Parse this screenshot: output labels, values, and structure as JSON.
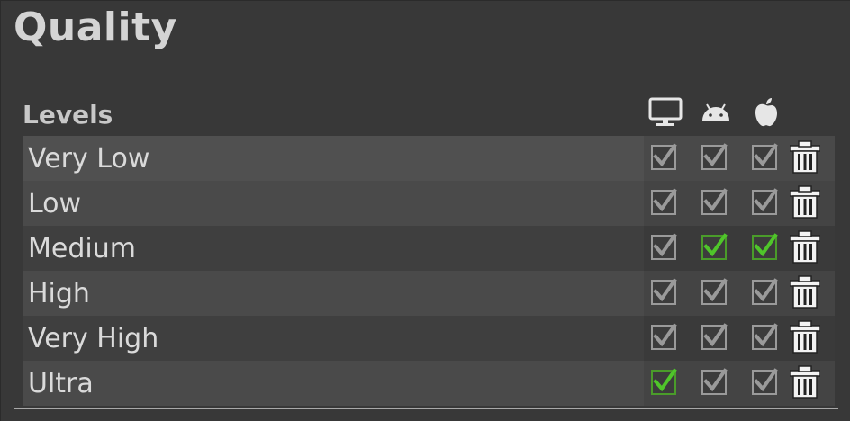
{
  "title": "Quality",
  "levels_label": "Levels",
  "platforms": [
    {
      "icon": "monitor-icon",
      "name": "Standalone"
    },
    {
      "icon": "android-icon",
      "name": "Android"
    },
    {
      "icon": "apple-icon",
      "name": "iOS"
    }
  ],
  "levels": [
    {
      "label": "Very Low",
      "checks": [
        {
          "checked": true,
          "default": false
        },
        {
          "checked": true,
          "default": false
        },
        {
          "checked": true,
          "default": false
        }
      ]
    },
    {
      "label": "Low",
      "checks": [
        {
          "checked": true,
          "default": false
        },
        {
          "checked": true,
          "default": false
        },
        {
          "checked": true,
          "default": false
        }
      ]
    },
    {
      "label": "Medium",
      "checks": [
        {
          "checked": true,
          "default": false
        },
        {
          "checked": true,
          "default": true
        },
        {
          "checked": true,
          "default": true
        }
      ]
    },
    {
      "label": "High",
      "checks": [
        {
          "checked": true,
          "default": false
        },
        {
          "checked": true,
          "default": false
        },
        {
          "checked": true,
          "default": false
        }
      ]
    },
    {
      "label": "Very High",
      "checks": [
        {
          "checked": true,
          "default": false
        },
        {
          "checked": true,
          "default": false
        },
        {
          "checked": true,
          "default": false
        }
      ]
    },
    {
      "label": "Ultra",
      "checks": [
        {
          "checked": true,
          "default": true
        },
        {
          "checked": true,
          "default": false
        },
        {
          "checked": true,
          "default": false
        }
      ]
    }
  ],
  "colors": {
    "background": "#383838",
    "check_normal": "#9a9a9a",
    "check_default": "#4fc62a"
  }
}
